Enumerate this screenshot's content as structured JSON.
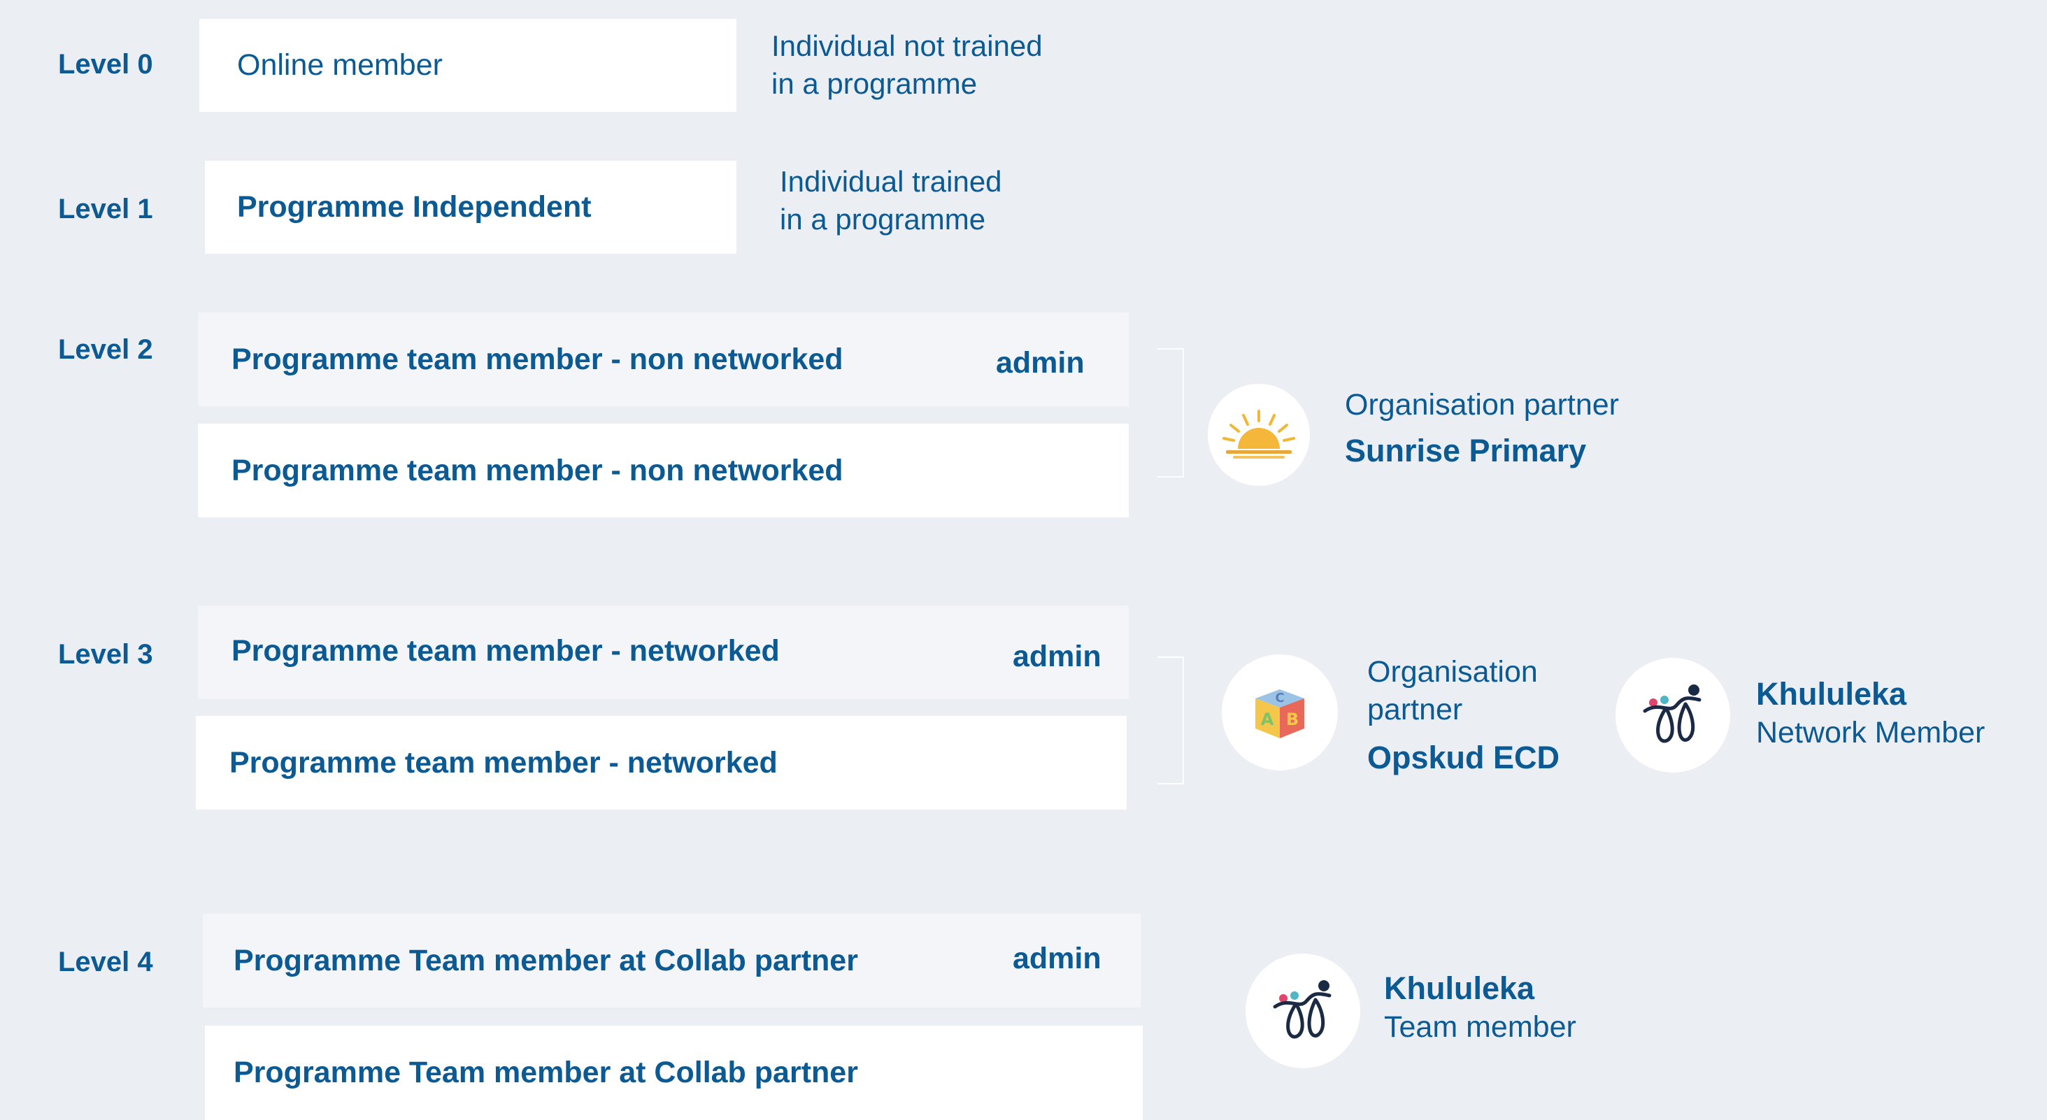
{
  "levels": [
    {
      "label": "Level 0",
      "box": "Online member",
      "description": [
        "Individual not trained",
        "in a programme"
      ]
    },
    {
      "label": "Level 1",
      "box": "Programme Independent",
      "description": [
        "Individual trained",
        "in a programme"
      ]
    },
    {
      "label": "Level 2",
      "box_admin": "Programme team member - non networked",
      "admin": "admin",
      "box": "Programme team member - non networked"
    },
    {
      "label": "Level 3",
      "box_admin": "Programme team member - networked",
      "admin": "admin",
      "box": "Programme team member - networked"
    },
    {
      "label": "Level 4",
      "box_admin": "Programme Team member at Collab partner",
      "admin": "admin",
      "box": "Programme Team member at Collab partner"
    }
  ],
  "partners": {
    "sunrise": {
      "line1": "Organisation partner",
      "name": "Sunrise Primary",
      "icon": "sunrise-icon"
    },
    "opskud": {
      "line1": "Organisation",
      "line2": "partner",
      "name": "Opskud ECD",
      "icon": "abc-block-icon"
    },
    "khululeka_network": {
      "name": "Khululeka",
      "role": "Network Member",
      "icon": "khululeka-logo-icon"
    },
    "khululeka_team": {
      "name": "Khululeka",
      "role": "Team member",
      "icon": "khululeka-logo-icon"
    }
  },
  "colors": {
    "background": "#ebeef2",
    "text": "#0b5a93",
    "box_white": "#ffffff",
    "box_light": "#f3f5f8"
  }
}
